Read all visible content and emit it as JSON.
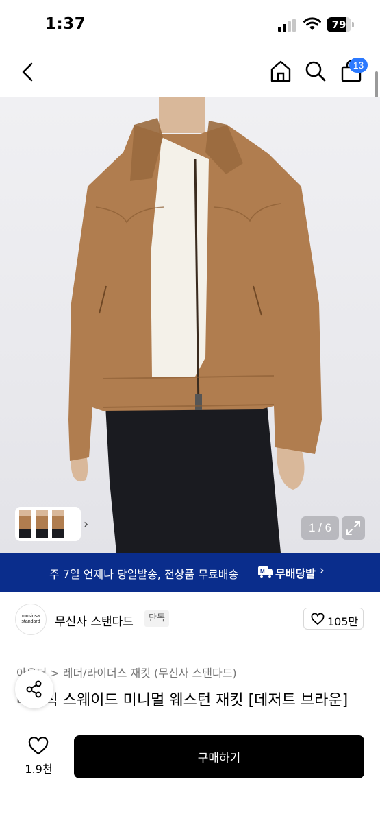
{
  "status_bar": {
    "time": "1:37",
    "battery_level": "79",
    "battery_fraction": 0.79
  },
  "header": {
    "cart_count": "13"
  },
  "gallery": {
    "counter": "1 / 6",
    "colors": {
      "jacket": "#b07d4f",
      "shirt": "#f4f1e9",
      "pants": "#1a1b20",
      "skin": "#d9b89a"
    }
  },
  "banner": {
    "text": "주 7일 언제나 당일발송, 전상품 무료배송",
    "logo_text": "무배당발",
    "background": "#0a2d8c"
  },
  "brand": {
    "logo_line1": "musinsa",
    "logo_line2": "standard",
    "name": "무신사 스탠다드",
    "tag": "단독",
    "like_count": "105만"
  },
  "product": {
    "breadcrumb": "아우터 > 레더/라이더스 재킷 (무신사 스탠다드)",
    "title": "베이직 스웨이드 미니멀 웨스턴 재킷 [데저트 브라운]"
  },
  "bottom_bar": {
    "wish_count": "1.9천",
    "buy_label": "구매하기"
  }
}
